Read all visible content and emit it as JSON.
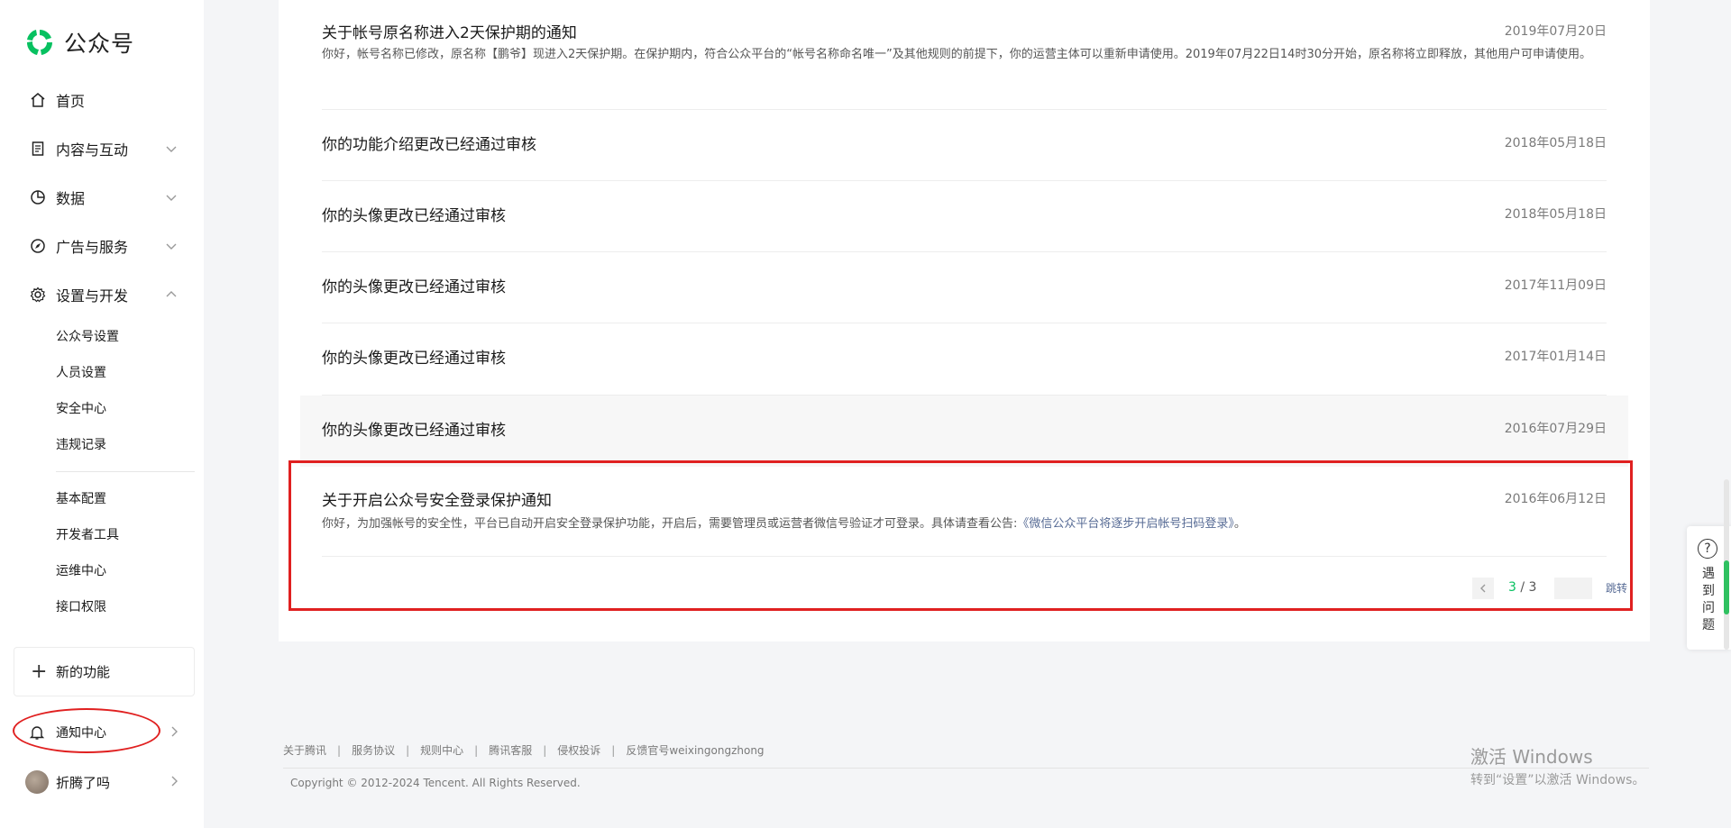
{
  "brand": {
    "name": "公众号",
    "accent": "#07c160"
  },
  "sidebar": {
    "nav": [
      {
        "label": "首页",
        "icon": "home-icon"
      },
      {
        "label": "内容与互动",
        "icon": "document-icon"
      },
      {
        "label": "数据",
        "icon": "pie-chart-icon"
      },
      {
        "label": "广告与服务",
        "icon": "compass-icon"
      },
      {
        "label": "设置与开发",
        "icon": "gear-icon"
      }
    ],
    "settings_sub": [
      "公众号设置",
      "人员设置",
      "安全中心",
      "违规记录"
    ],
    "dev_sub": [
      "基本配置",
      "开发者工具",
      "运维中心",
      "接口权限"
    ],
    "new_feature": "新的功能",
    "notice_center": "通知中心",
    "user_name": "折腾了吗"
  },
  "notices": [
    {
      "title": "关于帐号原名称进入2天保护期的通知",
      "date": "2019年07月20日",
      "body": "你好，帐号名称已修改，原名称【鹏爷】现进入2天保护期。在保护期内，符合公众平台的“帐号名称命名唯一”及其他规则的前提下，你的运营主体可以重新申请使用。2019年07月22日14时30分开始，原名称将立即释放，其他用户可申请使用。"
    },
    {
      "title": "你的功能介绍更改已经通过审核",
      "date": "2018年05月18日"
    },
    {
      "title": "你的头像更改已经通过审核",
      "date": "2018年05月18日"
    },
    {
      "title": "你的头像更改已经通过审核",
      "date": "2017年11月09日"
    },
    {
      "title": "你的头像更改已经通过审核",
      "date": "2017年01月14日"
    },
    {
      "title": "你的头像更改已经通过审核",
      "date": "2016年07月29日"
    },
    {
      "title": "关于开启公众号安全登录保护通知",
      "date": "2016年06月12日",
      "body_prefix": "你好，为加强帐号的安全性，平台已自动开启安全登录保护功能，开启后，需要管理员或运营者微信号验证才可登录。具体请查看公告:",
      "body_link": "《微信公众平台将逐步开启帐号扫码登录》",
      "body_suffix": "。"
    }
  ],
  "pagination": {
    "current": "3",
    "separator": " / ",
    "total": "3",
    "jump_label": "跳转",
    "input_value": ""
  },
  "footer": {
    "links": [
      "关于腾讯",
      "服务协议",
      "规则中心",
      "腾讯客服",
      "侵权投诉",
      "反馈官号weixingongzhong"
    ],
    "copyright": "Copyright © 2012-2024 Tencent. All Rights Reserved."
  },
  "windows_watermark": {
    "line1": "激活 Windows",
    "line2": "转到“设置”以激活 Windows。"
  },
  "help_widget": {
    "icon": "question-icon",
    "label": "遇到问题"
  }
}
